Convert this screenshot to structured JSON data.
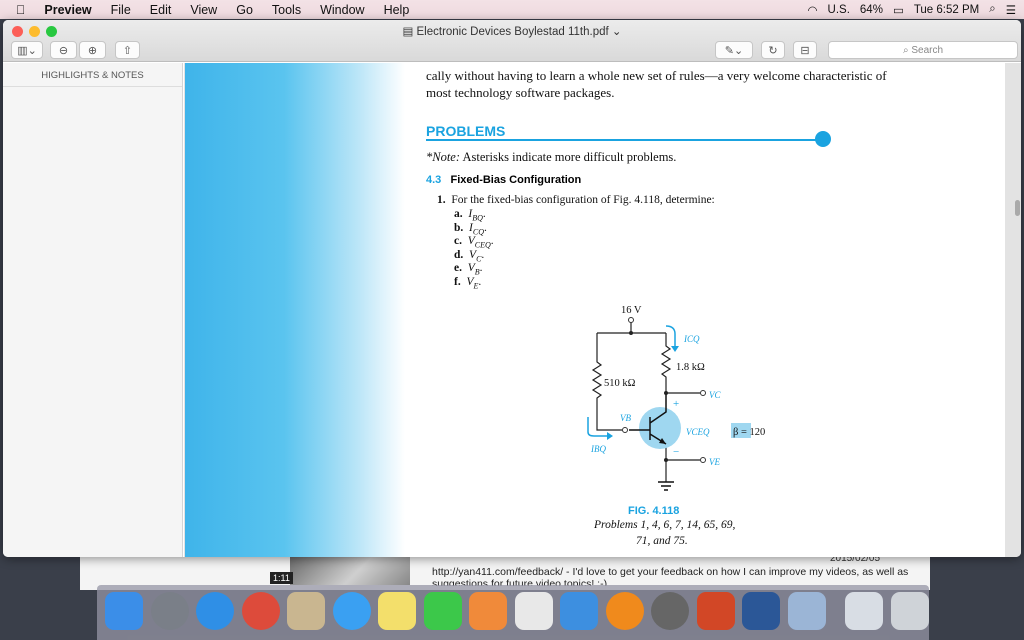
{
  "menubar": {
    "app": "Preview",
    "items": [
      "File",
      "Edit",
      "View",
      "Go",
      "Tools",
      "Window",
      "Help"
    ],
    "input_source": "U.S.",
    "battery": "64%",
    "clock": "Tue 6:52 PM"
  },
  "window": {
    "title": "Electronic Devices Boylestad 11th.pdf",
    "search_placeholder": "Search",
    "sidebar_header": "HIGHLIGHTS & NOTES"
  },
  "document": {
    "intro_line1": "cally without having to learn a whole new set of rules—a very welcome characteristic of",
    "intro_line2": "most technology software packages.",
    "heading": "PROBLEMS",
    "note_label": "*Note:",
    "note": " Asterisks indicate more difficult problems.",
    "section_num": "4.3",
    "section_title": "Fixed-Bias Configuration",
    "problem_num": "1.",
    "problem_text": "For the fixed-bias configuration of Fig. 4.118, determine:",
    "parts": [
      {
        "l": "a.",
        "v": "I",
        "s": "BQ"
      },
      {
        "l": "b.",
        "v": "I",
        "s": "CQ"
      },
      {
        "l": "c.",
        "v": "V",
        "s": "CEQ"
      },
      {
        "l": "d.",
        "v": "V",
        "s": "C"
      },
      {
        "l": "e.",
        "v": "V",
        "s": "B"
      },
      {
        "l": "f.",
        "v": "V",
        "s": "E"
      }
    ],
    "figure": {
      "supply": "16 V",
      "rc": "1.8 kΩ",
      "rb": "510 kΩ",
      "icq": "ICQ",
      "ibq": "IBQ",
      "vb": "VB",
      "vc": "VC",
      "ve": "VE",
      "vceq": "VCEQ",
      "plus": "+",
      "minus": "−",
      "beta": "β = 120",
      "caption": "FIG. 4.118",
      "caption_line1": "Problems 1, 4, 6, 7, 14, 65, 69,",
      "caption_line2": "71, and 75."
    }
  },
  "background": {
    "video_duration": "1:11",
    "feedback": "http://yan411.com/feedback/ - I'd love to get your feedback on how I can improve my videos, as well as suggestions for future video topics! :-)",
    "date": "2015/02/05"
  },
  "dock": [
    "Finder",
    "Launchpad",
    "Safari",
    "Chrome",
    "Mail",
    "Messages",
    "Notes",
    "FaceTime",
    "Pages",
    "Numbers",
    "Keynote",
    "iBooks",
    "System Preferences",
    "PowerPoint",
    "Word",
    "Preview",
    "Documents",
    "Trash"
  ],
  "colors": {
    "accent": "#1aa3e0"
  }
}
